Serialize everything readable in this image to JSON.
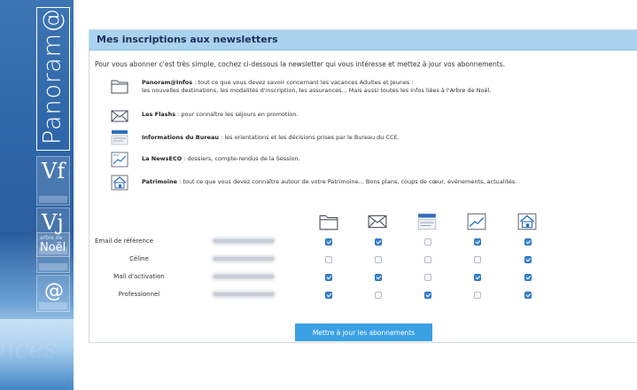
{
  "sidebar": {
    "brand": "Panoram@",
    "tiles": [
      {
        "big": "Vf",
        "name": "vf"
      },
      {
        "big": "Vj",
        "name": "vj"
      },
      {
        "big": "Noël",
        "tiny": "arbre de",
        "name": "noel"
      },
      {
        "big": "@",
        "name": "at"
      }
    ],
    "wave_text": "nces"
  },
  "panel": {
    "title": "Mes inscriptions aux newsletters",
    "intro": "Pour vous abonner c'est très simple, cochez ci-dessous la newsletter qui vous intéresse et mettez à jour vos abonnements."
  },
  "newsletters": [
    {
      "icon": "folder-icon",
      "title": "Panoram@Infos",
      "desc": " : tout ce que vous devez savoir concernant les vacances Adultes et Jeunes :",
      "desc2": "les nouvelles destinations, les modalités d'inscription, les assurances... Mais aussi toutes les infos liées à l'Arbre de Noël."
    },
    {
      "icon": "envelope-icon",
      "title": "Les Flashs",
      "desc": " : pour connaître les séjours en promotion."
    },
    {
      "icon": "info-bureau-icon",
      "title": "Informations du Bureau",
      "desc": " : les orientations et les décisions prises par le Bureau du CCE."
    },
    {
      "icon": "chart-icon",
      "title": "La NewsECO",
      "desc": " : dossiers, compte-rendus de la Session."
    },
    {
      "icon": "house-icon",
      "title": "Patrimoine",
      "desc": " : tout ce que vous devez connaître autour de votre Patrimoine... Bons plans, coups de cœur, événements, actualités."
    }
  ],
  "matrix": {
    "rows": [
      {
        "label": "Email de référence",
        "checks": [
          true,
          true,
          false,
          true,
          true
        ]
      },
      {
        "label": "Céline",
        "checks": [
          false,
          false,
          false,
          false,
          true
        ]
      },
      {
        "label": "Mail d'activation",
        "checks": [
          true,
          true,
          false,
          true,
          true
        ]
      },
      {
        "label": "Professionnel",
        "checks": [
          true,
          false,
          true,
          false,
          true
        ]
      }
    ]
  },
  "submit_label": "Mettre à jour les abonnements",
  "colors": {
    "header": "#a9d3ef",
    "button": "#3aa0e4",
    "checked": "#3a86d4"
  }
}
